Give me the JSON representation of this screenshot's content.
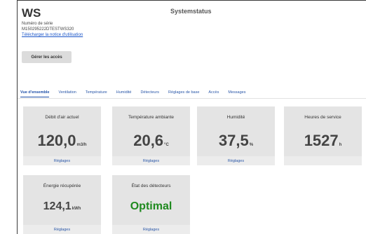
{
  "header": {
    "device_name": "WS",
    "title": "Systemstatus",
    "serial_label": "Numéro de série",
    "serial_value": "M150295222DTESTWS320",
    "manual_link": "Télécharger la notice d'utilisation",
    "access_button": "Gérer les accès"
  },
  "tabs": [
    {
      "label": "Vue d'ensemble",
      "active": true
    },
    {
      "label": "Ventilation"
    },
    {
      "label": "Température"
    },
    {
      "label": "Humidité"
    },
    {
      "label": "Détecteurs"
    },
    {
      "label": "Réglages de base"
    },
    {
      "label": "Accès"
    },
    {
      "label": "Messages"
    }
  ],
  "cards": {
    "airflow": {
      "title": "Débit d'air actuel",
      "value": "120,0",
      "unit": "m3/h",
      "link": "Réglages"
    },
    "temperature": {
      "title": "Température ambiante",
      "value": "20,6",
      "unit": "°C",
      "link": "Réglages"
    },
    "humidity": {
      "title": "Humidité",
      "value": "37,5",
      "unit": "%",
      "link": "Réglages"
    },
    "hours": {
      "title": "Heures de service",
      "value": "1527",
      "unit": "h",
      "link": ""
    },
    "energy": {
      "title": "Énergie récupérée",
      "value": "124,1",
      "unit": "kWh",
      "link": "Réglages"
    },
    "detectors": {
      "title": "État des détecteurs",
      "value": "Optimal",
      "link": "Réglages"
    }
  },
  "colors": {
    "link": "#2a57a8",
    "status_ok": "#1f8a1f",
    "card_bg": "#e4e4e4",
    "button_bg": "#dcdcdc"
  }
}
